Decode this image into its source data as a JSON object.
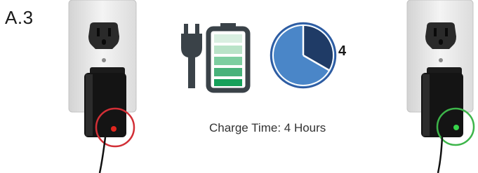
{
  "step": {
    "label": "A.3"
  },
  "timer": {
    "hours_label": "4",
    "hours": 4,
    "elapsed_fraction": 0.333
  },
  "battery": {
    "filled_segments": 5,
    "total_segments": 5
  },
  "caption": {
    "text": "Charge Time: 4 Hours"
  },
  "indicators": {
    "left": {
      "led": "red",
      "ring_color": "#d22f36",
      "led_color": "#e0261e"
    },
    "right": {
      "led": "green",
      "ring_color": "#3db54a",
      "led_color": "#37d24a"
    }
  },
  "colors": {
    "battery_outline": "#3a4248",
    "battery_fills": [
      "#d9efe1",
      "#b9e3c8",
      "#7dcea0",
      "#48b27a",
      "#16a05a"
    ],
    "clock_face": "#4a86c8",
    "clock_wedge": "#1f3b66",
    "clock_rim": "#2d5aa0"
  }
}
